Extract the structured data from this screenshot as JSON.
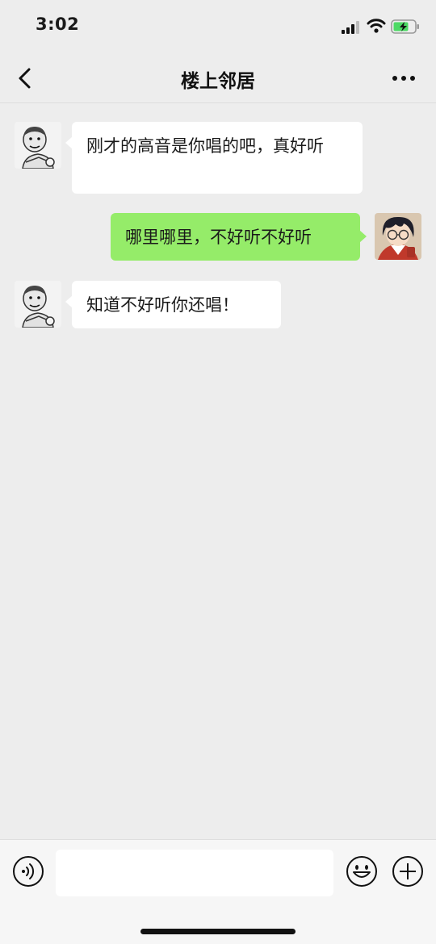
{
  "status_bar": {
    "time": "3:02"
  },
  "nav": {
    "title": "楼上邻居",
    "back_icon": "chevron-left-icon",
    "more_icon": "more-dots-icon"
  },
  "messages": [
    {
      "sender": "neighbor",
      "side": "left",
      "avatar": "meme-avatar",
      "text": "刚才的高音是你唱的吧，真好听"
    },
    {
      "sender": "me",
      "side": "right",
      "avatar": "anime-avatar",
      "text": "哪里哪里，不好听不好听"
    },
    {
      "sender": "neighbor",
      "side": "left",
      "avatar": "meme-avatar",
      "text": "知道不好听你还唱！"
    }
  ],
  "input_bar": {
    "voice_icon": "voice-icon",
    "input_value": "",
    "emoji_icon": "emoji-icon",
    "plus_icon": "plus-icon"
  },
  "colors": {
    "background": "#ededed",
    "incoming_bubble": "#ffffff",
    "outgoing_bubble": "#95ec69",
    "battery_fill": "#4cd964"
  }
}
